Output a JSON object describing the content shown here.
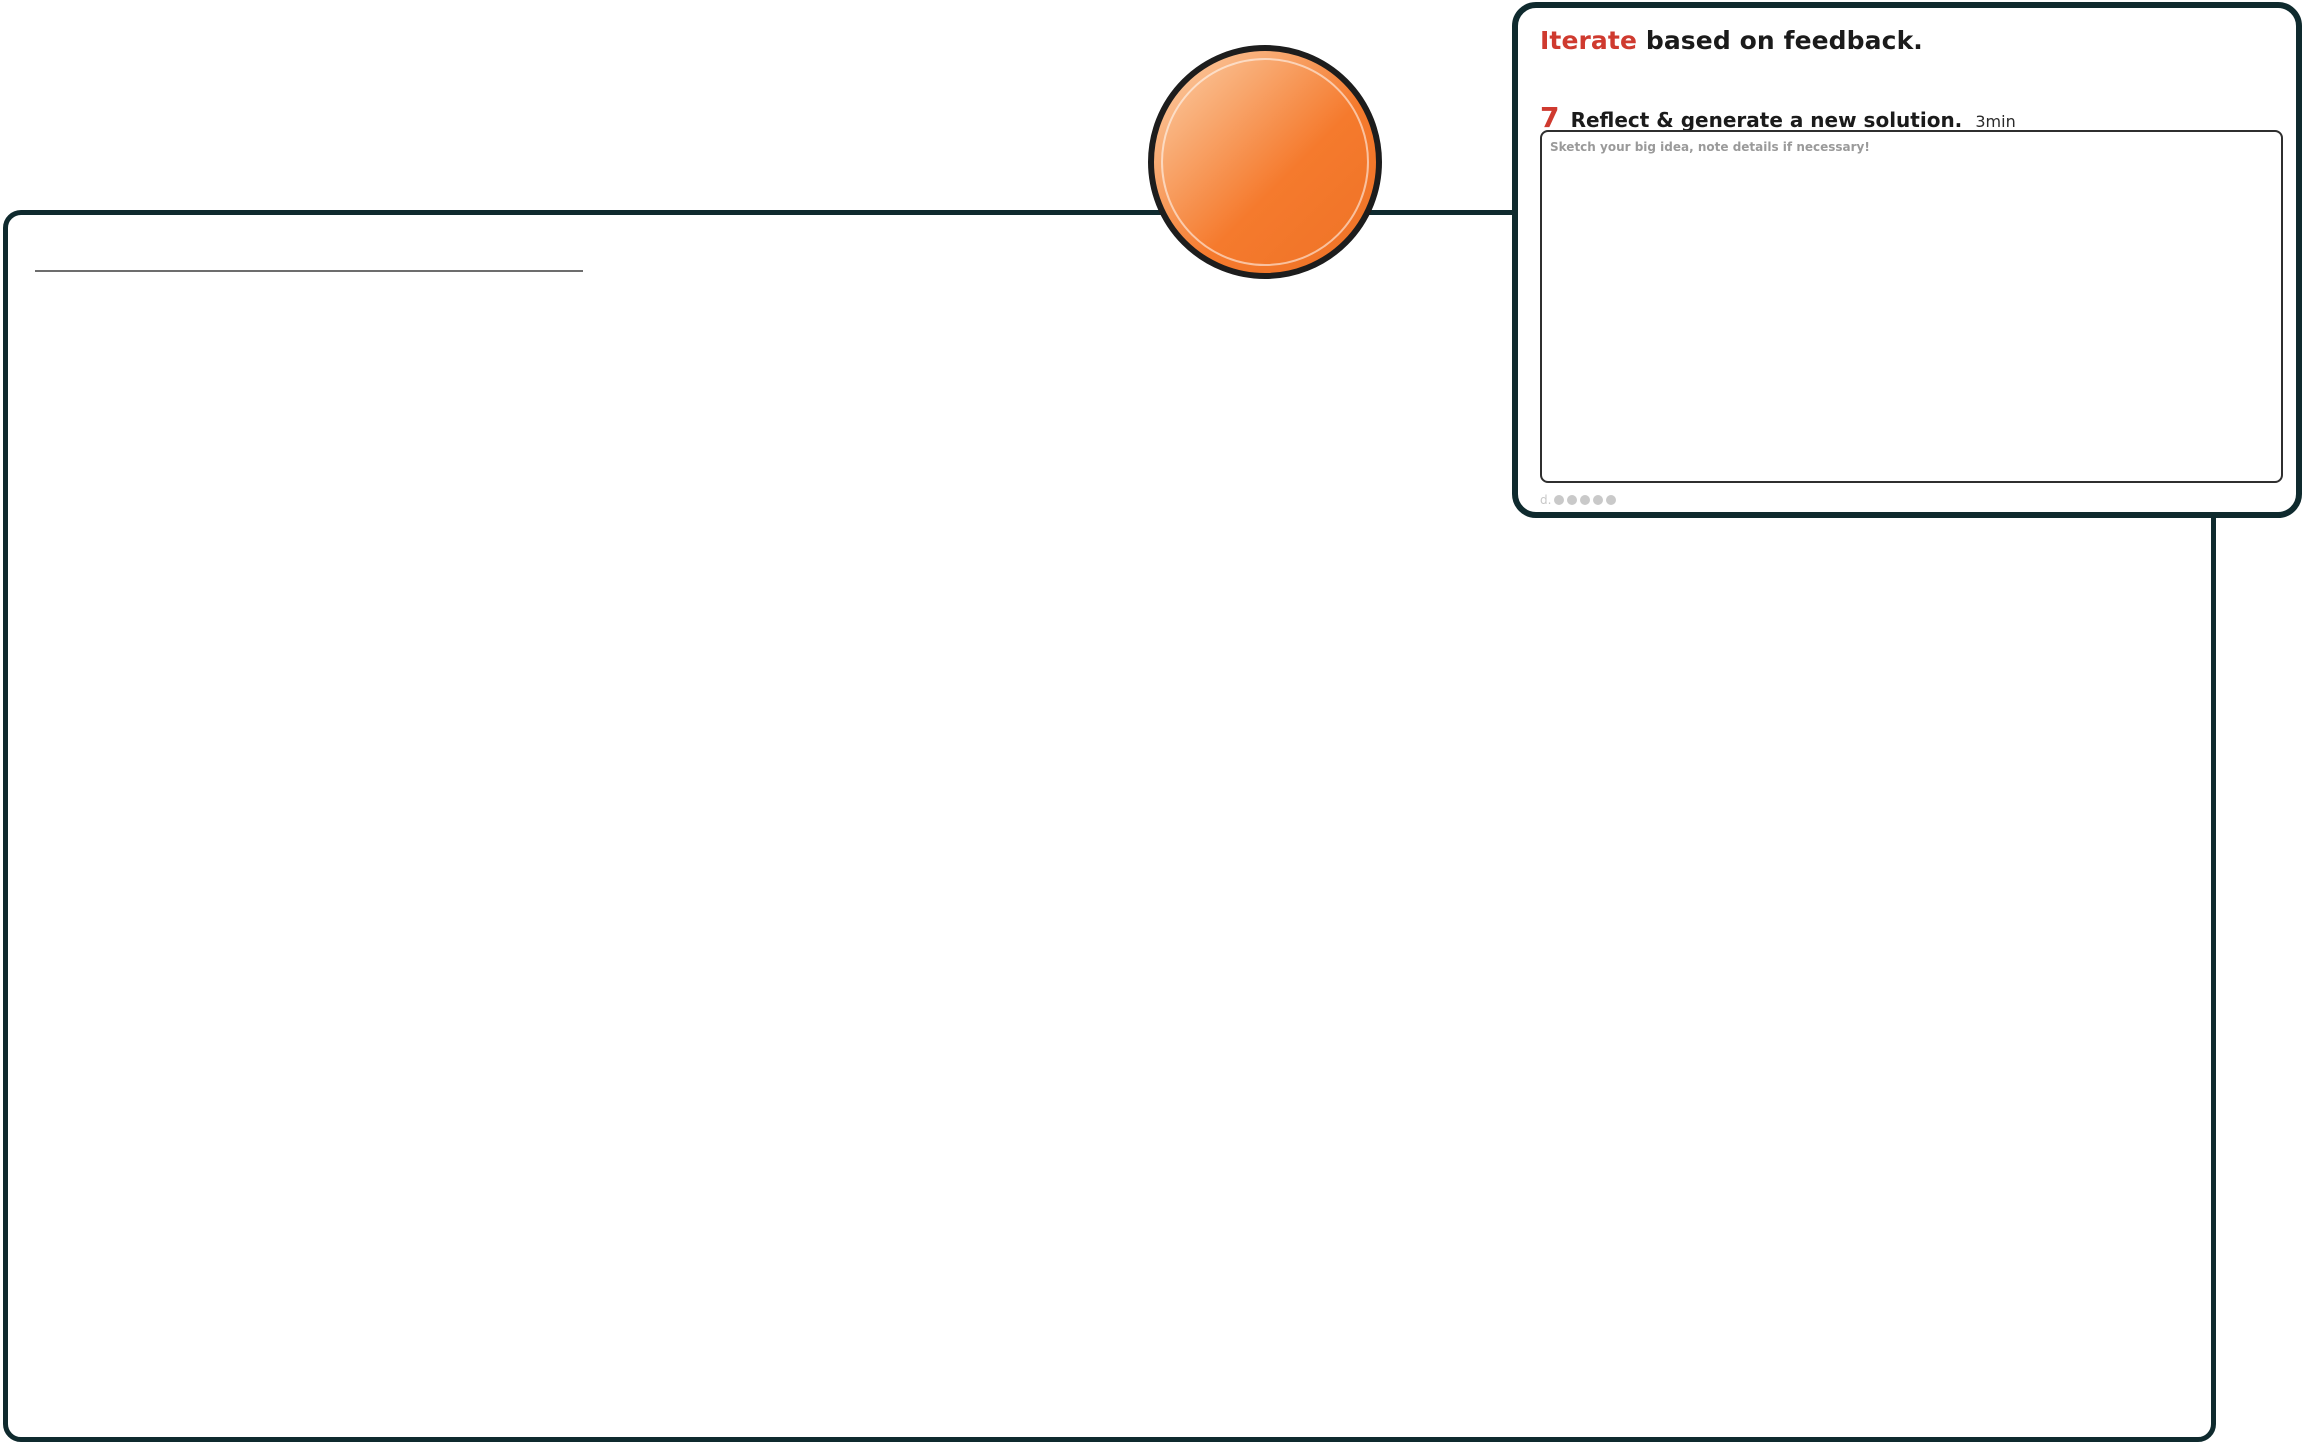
{
  "board": {},
  "card": {
    "title_accent": "Iterate",
    "title_rest": " based on feedback.",
    "step_number": "7",
    "step_title": "Reflect & generate a new solution.",
    "step_time": "3min",
    "sketch_placeholder": "Sketch your big idea, note details if necessary!",
    "footer_text": "d."
  },
  "colors": {
    "accent": "#cf3a2f",
    "border": "#0f2a2e",
    "orb": "#f57a2d"
  }
}
